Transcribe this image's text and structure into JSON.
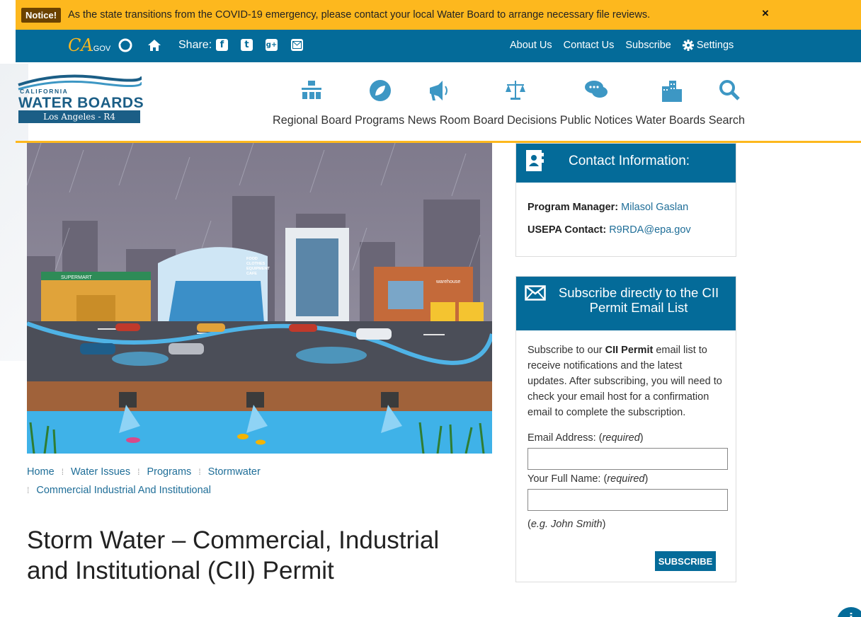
{
  "notice": {
    "badge": "Notice!",
    "text": "As the state transitions from the COVID-19 emergency, please contact your local Water Board to arrange necessary file reviews.",
    "close": "×"
  },
  "topbar": {
    "ca_logo": "CA",
    "ca_logo_sub": ".GOV",
    "share_label": "Share:",
    "links": [
      "About Us",
      "Contact Us",
      "Subscribe",
      "Settings"
    ]
  },
  "logo": {
    "top": "CALIFORNIA",
    "title": "WATER BOARDS",
    "sub": "Los Angeles - R4"
  },
  "nav": {
    "items": [
      "Regional Board",
      "Programs",
      "News Room",
      "Board Decisions",
      "Public Notices",
      "Water Boards",
      "Search"
    ]
  },
  "breadcrumb": {
    "items": [
      "Home",
      "Water Issues",
      "Programs",
      "Stormwater",
      "Commercial Industrial And Institutional"
    ]
  },
  "page_title": "Storm Water – Commercial, Industrial and Institutional (CII) Permit",
  "hero": {
    "food_sign": [
      "FOOD",
      "CLOTHES",
      "EQUIPMENT",
      "CAFE"
    ],
    "supermart": "SUPERMART",
    "warehouse": "warehouse"
  },
  "contact": {
    "heading": "Contact Information:",
    "manager_label": "Program Manager:",
    "manager_name": "Milasol Gaslan",
    "usepa_label": "USEPA Contact:",
    "usepa_email": "R9RDA@epa.gov"
  },
  "subscribe": {
    "heading": "Subscribe directly to the CII Permit Email List",
    "intro_before": "Subscribe to our ",
    "intro_bold": "CII Permit",
    "intro_after": " email list to receive notifications and the latest updates. After subscribing, you will need to check your email host for a confirmation email to complete the subscription.",
    "email_label": "Email Address: (",
    "email_req": "required",
    "name_label": "Your Full Name: (",
    "name_req": "required",
    "close_paren": ")",
    "example_open": "(",
    "example": "e.g. John Smith",
    "example_close": ")",
    "button": "SUBSCRIBE"
  },
  "colors": {
    "notice_bg": "#fdb81e",
    "brand_blue": "#046b99",
    "link_blue": "#1f6e98",
    "icon_blue": "#3d97c4"
  }
}
